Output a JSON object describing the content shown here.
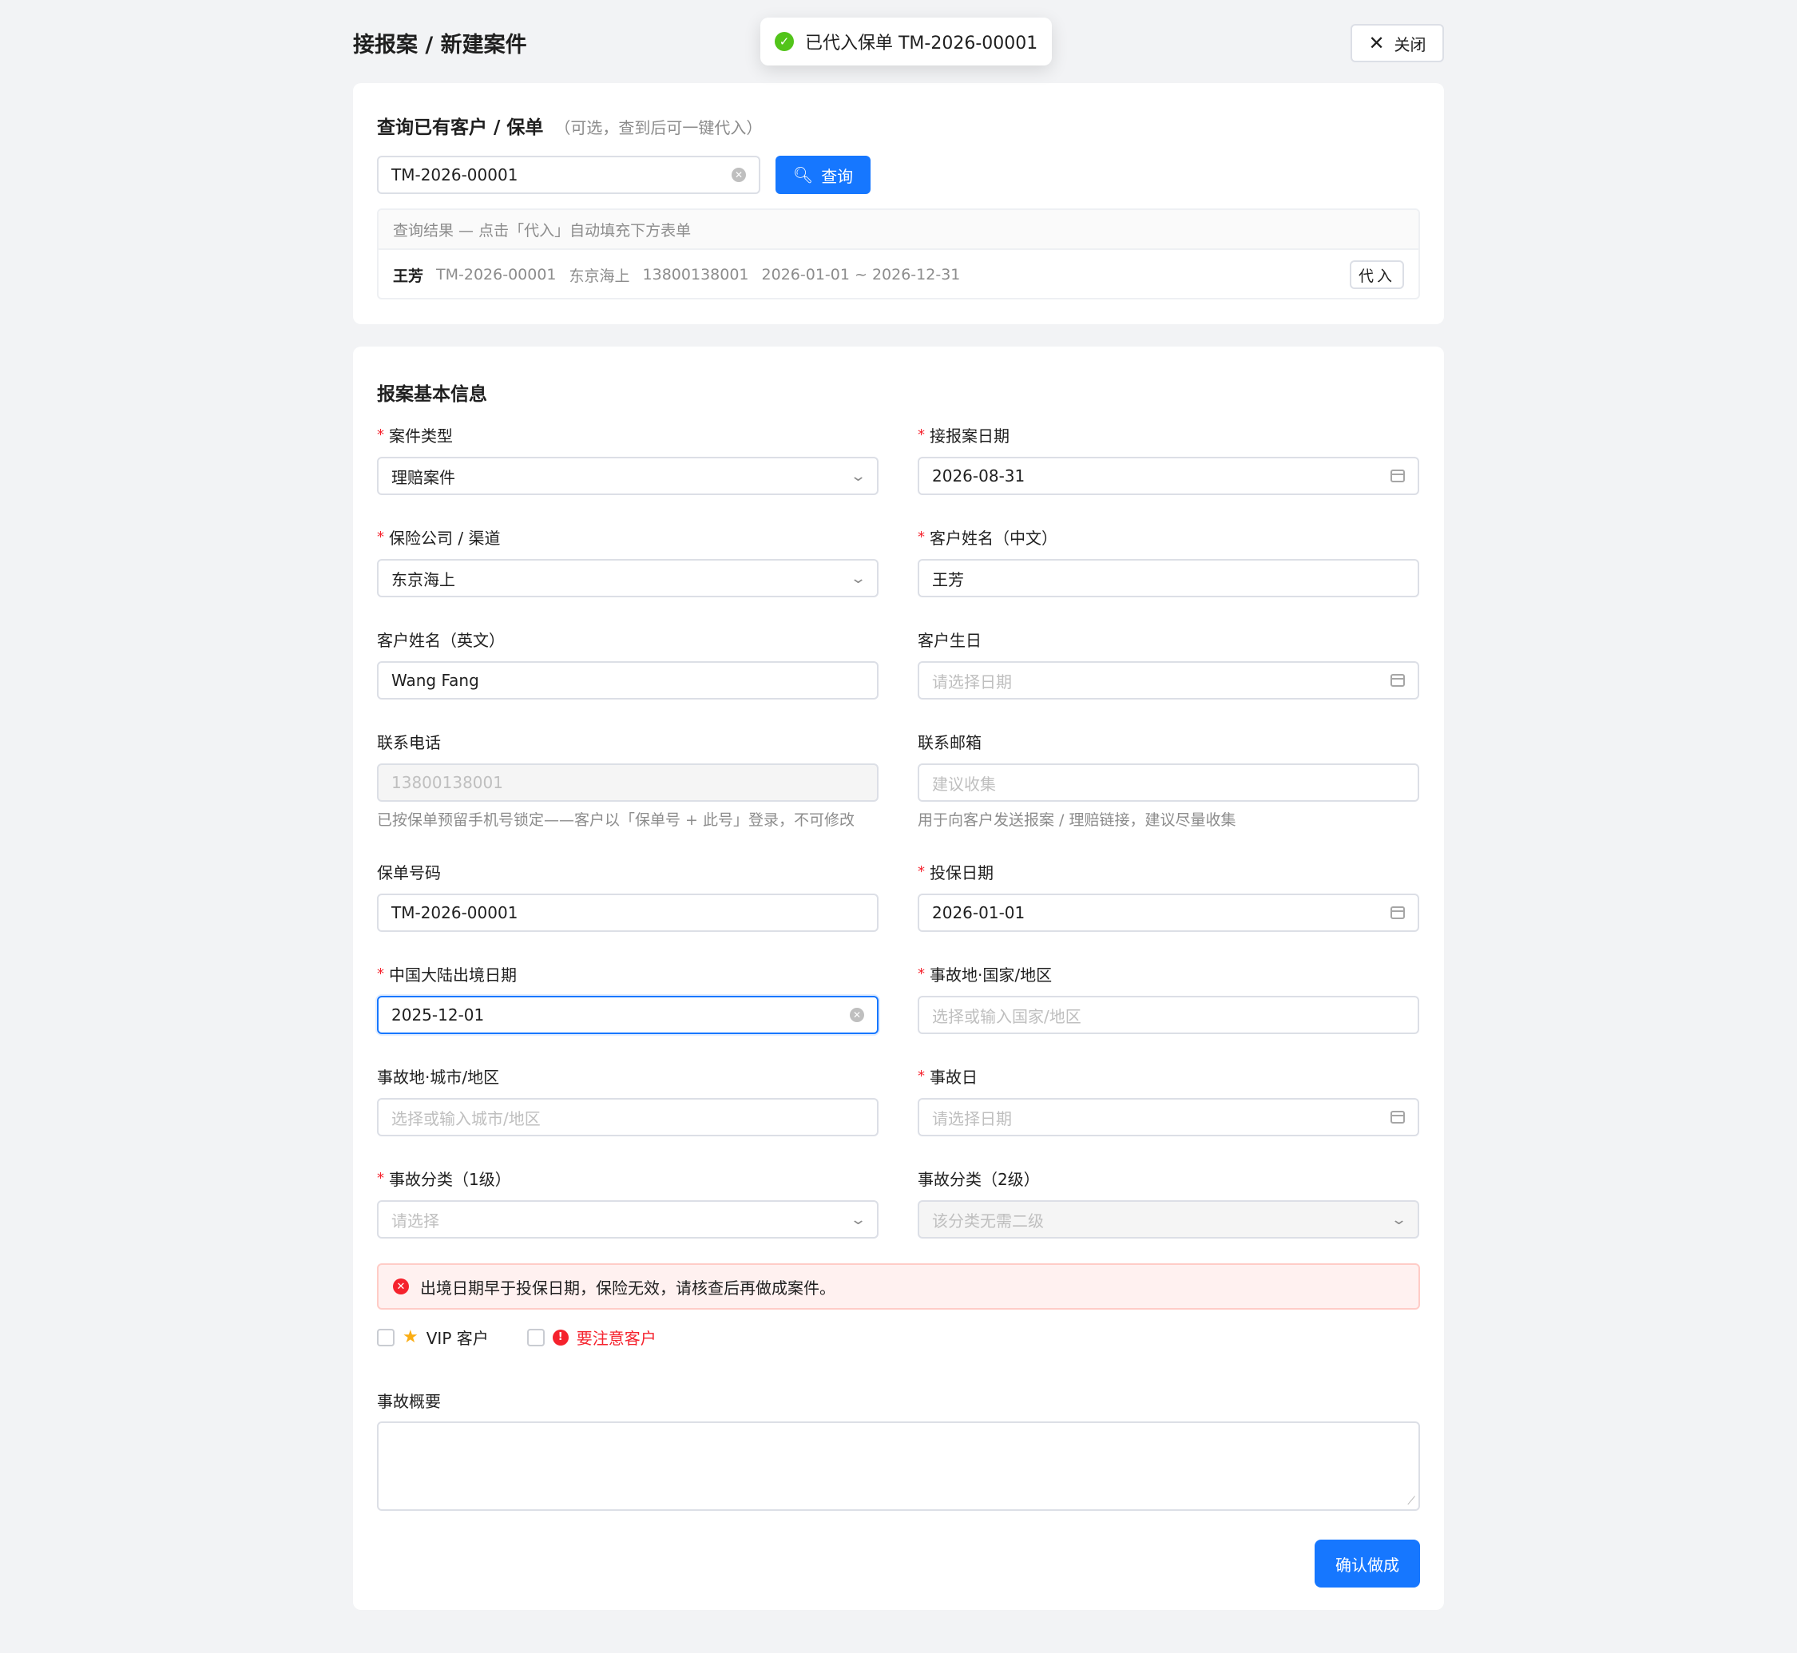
{
  "header": {
    "title": "接报案 / 新建案件",
    "close_label": "关闭"
  },
  "toast": {
    "text": "已代入保单 TM-2026-00001"
  },
  "search": {
    "title": "查询已有客户 / 保单",
    "subtitle": "（可选，查到后可一键代入）",
    "input_value": "TM-2026-00001",
    "button_label": "查询",
    "results_header": "查询结果 — 点击「代入」自动填充下方表单",
    "results": [
      {
        "name": "王芳",
        "policy": "TM-2026-00001",
        "insurer": "东京海上",
        "phone": "13800138001",
        "period": "2026-01-01 ~ 2026-12-31",
        "action": "代入"
      }
    ]
  },
  "form": {
    "title": "报案基本信息",
    "fields": {
      "case_type": {
        "label": "案件类型",
        "value": "理赔案件"
      },
      "report_date": {
        "label": "接报案日期",
        "value": "2026-08-31"
      },
      "insurer": {
        "label": "保险公司 / 渠道",
        "value": "东京海上"
      },
      "name_cn": {
        "label": "客户姓名（中文）",
        "value": "王芳"
      },
      "name_en": {
        "label": "客户姓名（英文）",
        "value": "Wang Fang"
      },
      "birthday": {
        "label": "客户生日",
        "placeholder": "请选择日期"
      },
      "phone": {
        "label": "联系电话",
        "value": "13800138001",
        "hint": "已按保单预留手机号锁定——客户以「保单号 + 此号」登录，不可修改"
      },
      "email": {
        "label": "联系邮箱",
        "placeholder": "建议收集",
        "hint": "用于向客户发送报案 / 理赔链接，建议尽量收集"
      },
      "policy_no": {
        "label": "保单号码",
        "value": "TM-2026-00001"
      },
      "policy_date": {
        "label": "投保日期",
        "value": "2026-01-01"
      },
      "exit_date": {
        "label": "中国大陆出境日期",
        "value": "2025-12-01"
      },
      "accident_country": {
        "label": "事故地·国家/地区",
        "placeholder": "选择或输入国家/地区"
      },
      "accident_city": {
        "label": "事故地·城市/地区",
        "placeholder": "选择或输入城市/地区"
      },
      "accident_date": {
        "label": "事故日",
        "placeholder": "请选择日期"
      },
      "category1": {
        "label": "事故分类（1级）",
        "placeholder": "请选择"
      },
      "category2": {
        "label": "事故分类（2级）",
        "placeholder": "该分类无需二级"
      }
    },
    "alert": "出境日期早于投保日期，保险无效，请核查后再做成案件。",
    "vip_label": "VIP 客户",
    "attention_label": "要注意客户",
    "summary_label": "事故概要",
    "submit_label": "确认做成"
  },
  "required_mark": "*",
  "colors": {
    "primary": "#1677ff",
    "error": "#f5222d",
    "success": "#52c41a",
    "star": "#faad14"
  }
}
